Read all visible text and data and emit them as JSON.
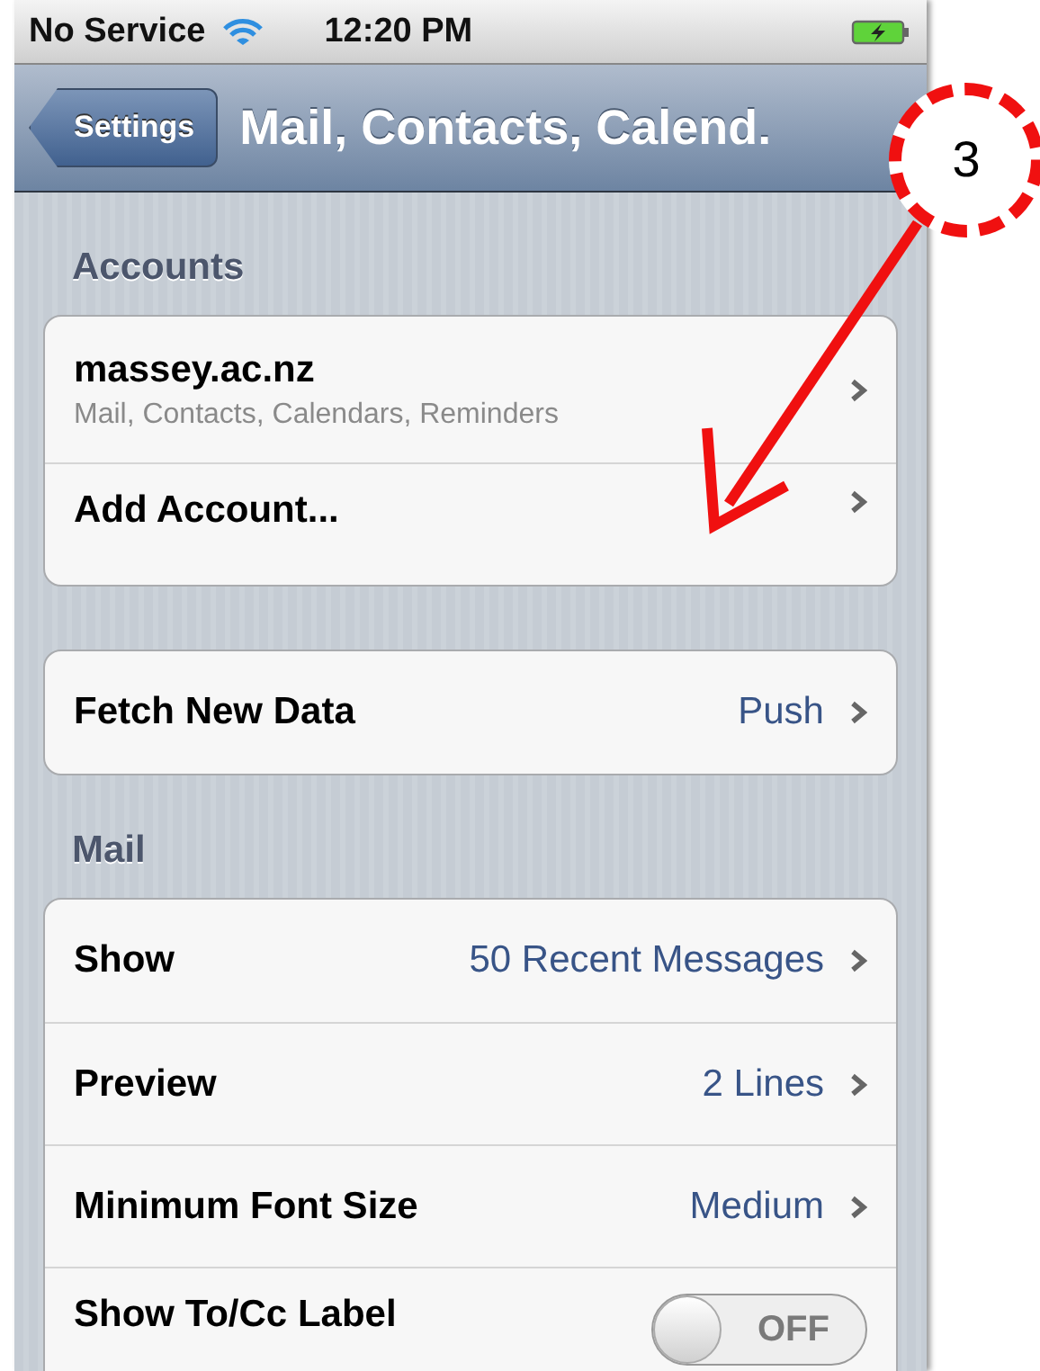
{
  "status_bar": {
    "carrier": "No Service",
    "time": "12:20 PM"
  },
  "nav_bar": {
    "back_button": "Settings",
    "title": "Mail, Contacts, Calend."
  },
  "sections": [
    {
      "header": "Accounts",
      "rows": [
        {
          "kind": "link",
          "label": "massey.ac.nz",
          "subtitle": "Mail, Contacts, Calendars, Reminders"
        },
        {
          "kind": "link",
          "label": "Add Account..."
        }
      ]
    },
    {
      "rows": [
        {
          "kind": "link",
          "label": "Fetch New Data",
          "value": "Push"
        }
      ]
    },
    {
      "header": "Mail",
      "rows": [
        {
          "kind": "link",
          "label": "Show",
          "value": "50 Recent Messages"
        },
        {
          "kind": "link",
          "label": "Preview",
          "value": "2 Lines"
        },
        {
          "kind": "link",
          "label": "Minimum Font Size",
          "value": "Medium"
        },
        {
          "kind": "toggle",
          "label": "Show To/Cc Label",
          "on": false,
          "state_label": "OFF"
        }
      ]
    }
  ],
  "callout": {
    "number": "3"
  }
}
